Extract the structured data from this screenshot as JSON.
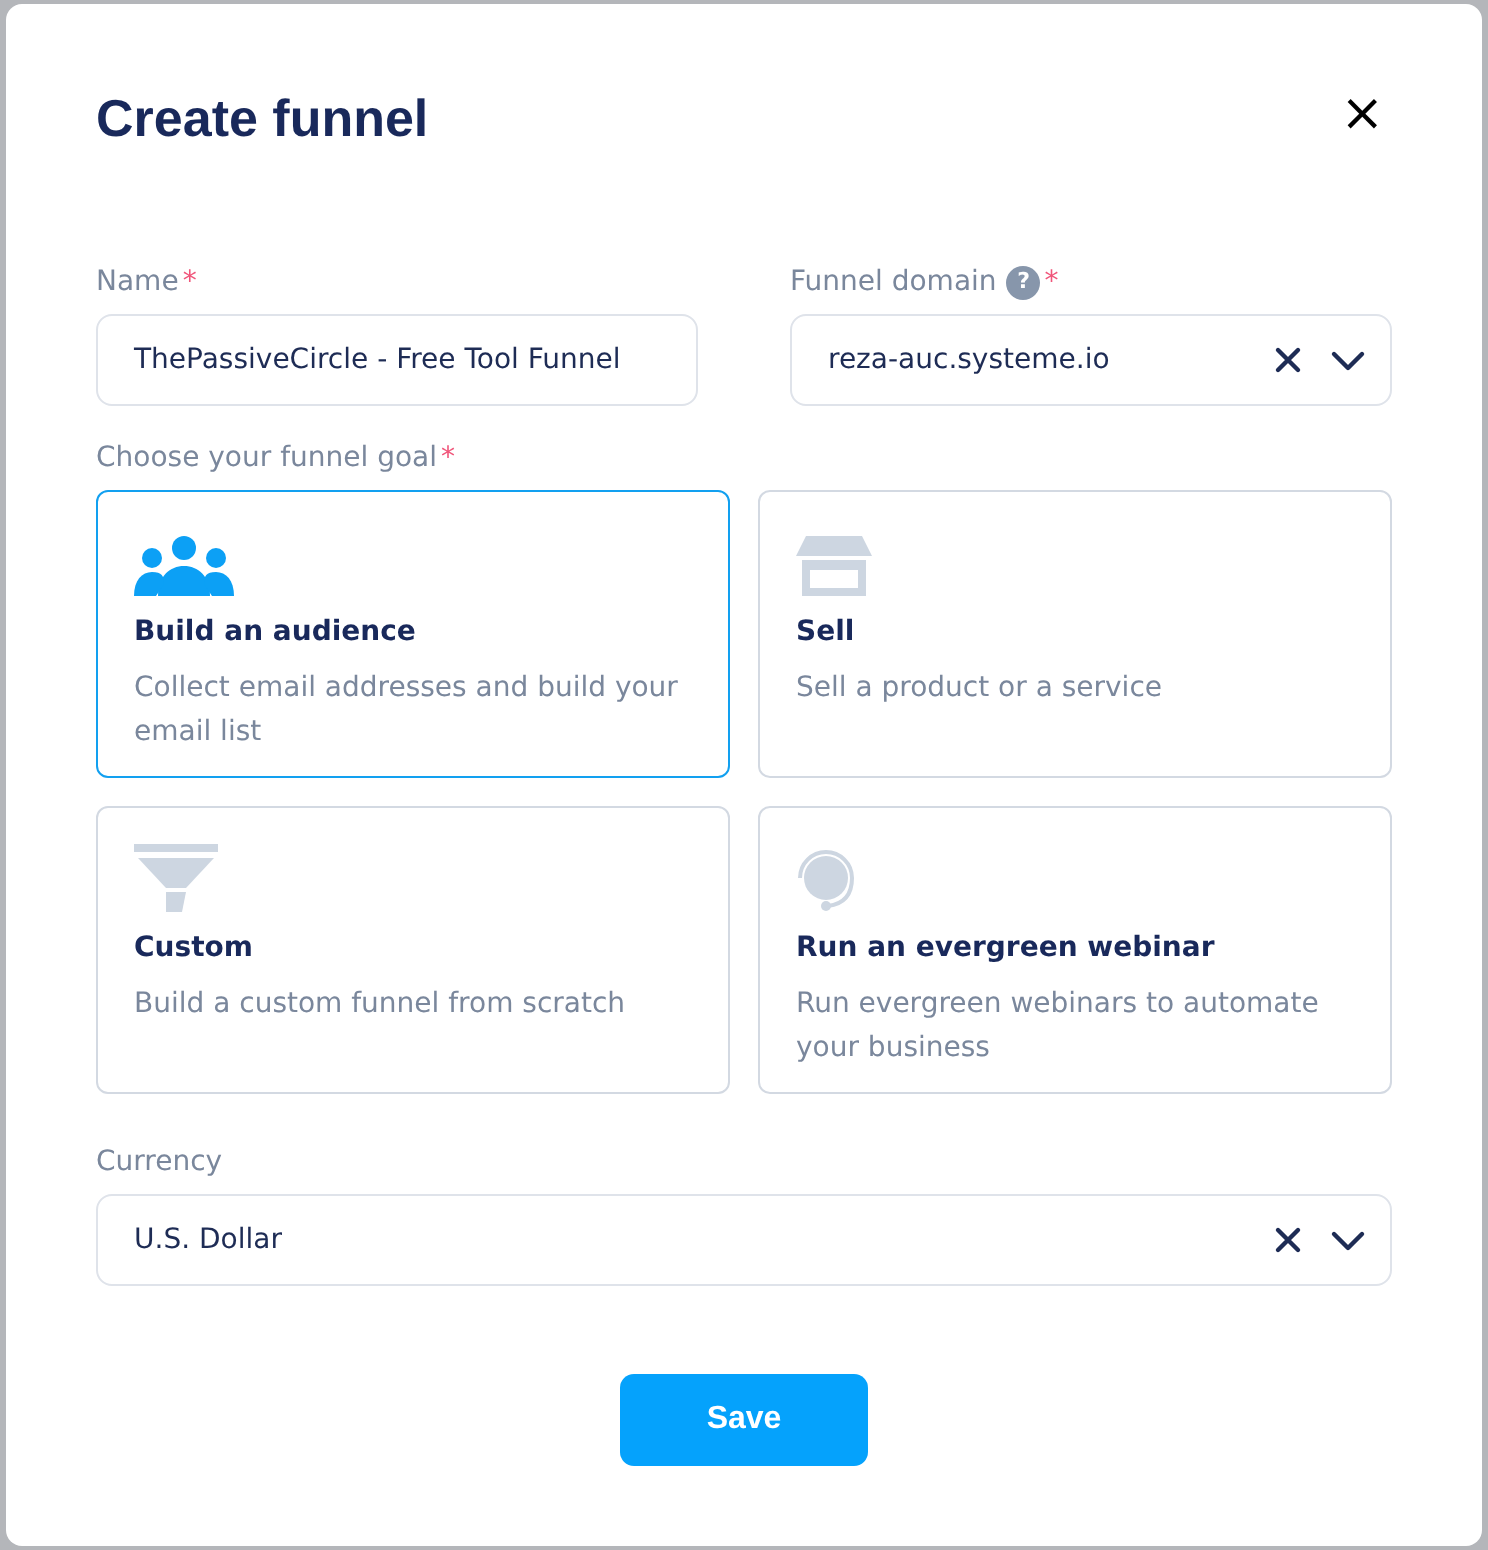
{
  "dialog": {
    "title": "Create funnel",
    "close": "×"
  },
  "fields": [
    {
      "label": "Name",
      "required_mark": "*",
      "value": "ThePassiveCircle - Free Tool Funnel",
      "kind": "text"
    },
    {
      "label": "Funnel domain",
      "help": "?",
      "required_mark": "*",
      "value": "reza-auc.systeme.io",
      "kind": "select"
    }
  ],
  "goal": {
    "label": "Choose your funnel goal",
    "required_mark": "*",
    "options": [
      {
        "kind": "audience",
        "title": "Build an audience",
        "description": "Collect email addresses and build your email list",
        "selected": true
      },
      {
        "kind": "shop",
        "title": "Sell",
        "description": "Sell a product or a service",
        "selected": false
      },
      {
        "kind": "funnel",
        "title": "Custom",
        "description": "Build a custom funnel from scratch",
        "selected": false
      },
      {
        "kind": "headset",
        "title": "Run an evergreen webinar",
        "description": "Run evergreen webinars to automate your business",
        "selected": false
      }
    ]
  },
  "currency": {
    "label": "Currency",
    "value": "U.S. Dollar",
    "kind": "select"
  },
  "save_button": "Save"
}
